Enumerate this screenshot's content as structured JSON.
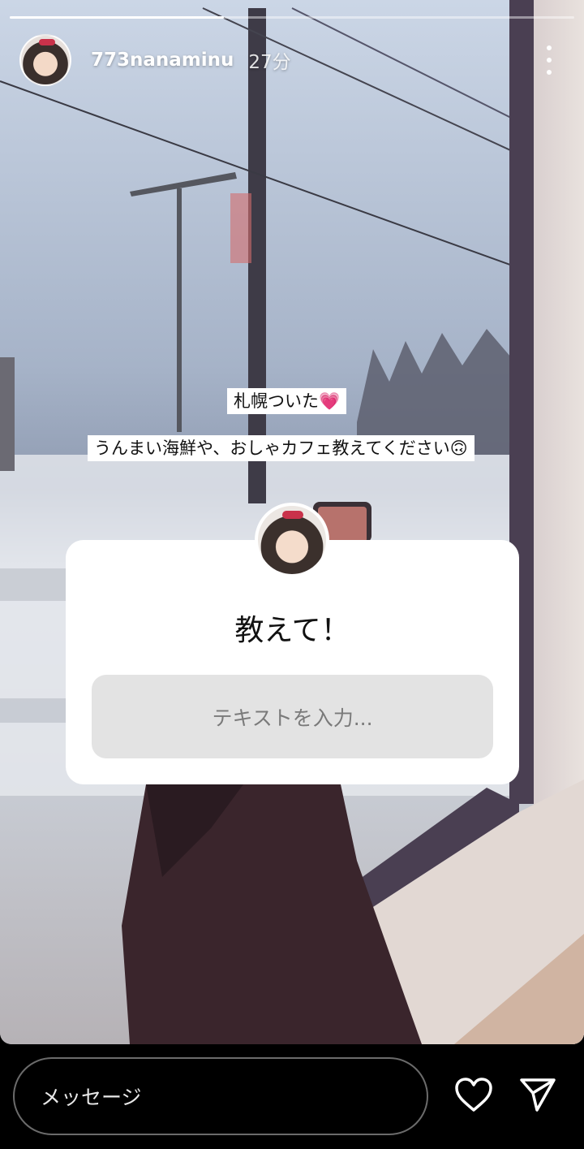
{
  "story": {
    "username": "773nanaminu",
    "time": "27分",
    "progress": 0.38,
    "captions": [
      "札幌ついた💗",
      "うんまい海鮮や、おしゃカフェ教えてください🙃"
    ]
  },
  "question_sticker": {
    "title": "教えて！",
    "input_placeholder": "テキストを入力..."
  },
  "footer": {
    "message_placeholder": "メッセージ"
  },
  "icons": {
    "more": "more-vertical-icon",
    "like": "heart-icon",
    "share": "send-icon"
  }
}
